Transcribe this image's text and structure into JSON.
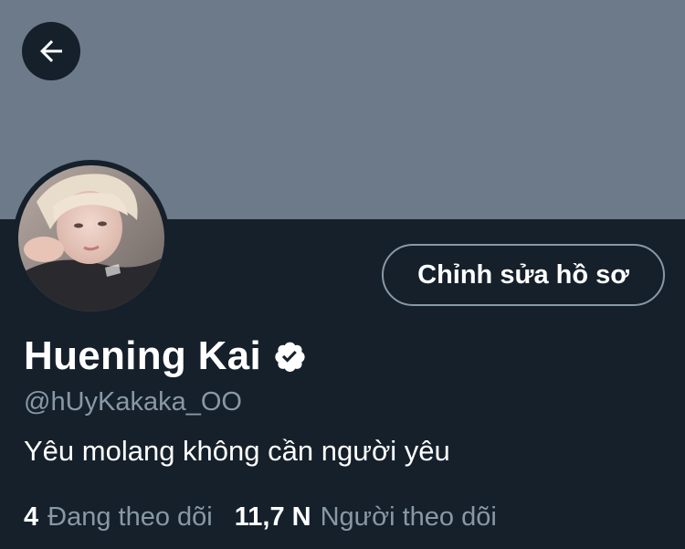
{
  "header": {
    "back_icon": "arrow-left-icon",
    "banner_color": "#6c7a8a"
  },
  "profile": {
    "display_name": "Huening Kai",
    "verified_icon": "verified-badge-icon",
    "handle": "@hUyKakaka_OO",
    "bio": "Yêu molang không cần người yêu",
    "edit_button_label": "Chỉnh sửa hồ sơ"
  },
  "stats": {
    "following_count": "4",
    "following_label": "Đang theo dõi",
    "followers_count": "11,7 N",
    "followers_label": "Người theo dõi"
  },
  "colors": {
    "background": "#15202b",
    "secondary_text": "#8899a6",
    "primary_text": "#ffffff"
  }
}
